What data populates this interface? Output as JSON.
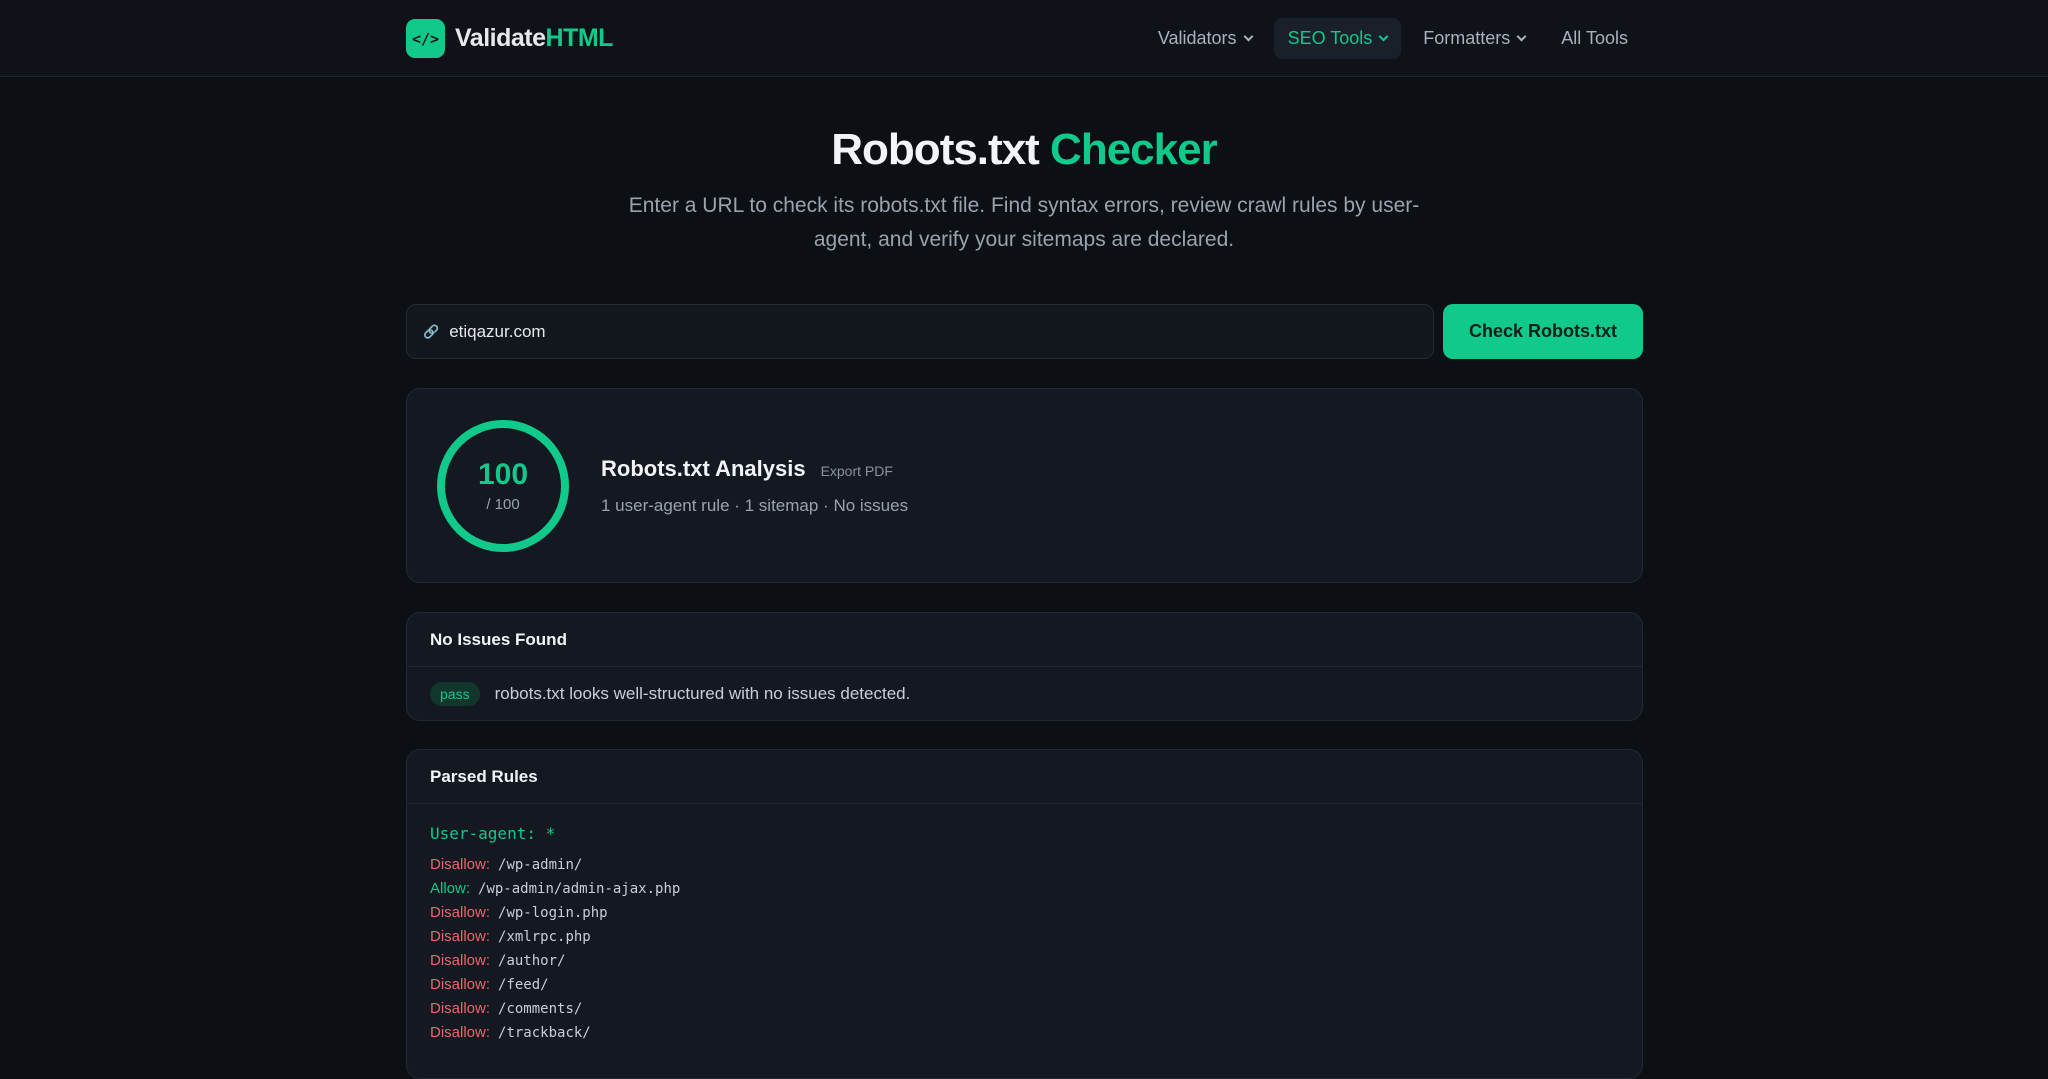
{
  "nav": {
    "brand_prefix": "Validate",
    "brand_suffix": "HTML",
    "logo_glyph": "</>",
    "items": [
      {
        "label": "Validators",
        "has_dropdown": true,
        "active": false
      },
      {
        "label": "SEO Tools",
        "has_dropdown": true,
        "active": true
      },
      {
        "label": "Formatters",
        "has_dropdown": true,
        "active": false
      },
      {
        "label": "All Tools",
        "has_dropdown": false,
        "active": false
      }
    ]
  },
  "hero": {
    "title_main": "Robots.txt",
    "title_accent": "Checker",
    "subtitle": "Enter a URL to check its robots.txt file. Find syntax errors, review crawl rules by user-agent, and verify your sitemaps are declared."
  },
  "search": {
    "value": "etiqazur.com",
    "button_label": "Check Robots.txt"
  },
  "analysis": {
    "score": "100",
    "score_max": "/ 100",
    "title": "Robots.txt Analysis",
    "export_label": "Export PDF",
    "summary": "1 user-agent rule · 1 sitemap · No issues"
  },
  "issues": {
    "header": "No Issues Found",
    "badge": "pass",
    "message": "robots.txt looks well-structured with no issues detected."
  },
  "rules": {
    "header": "Parsed Rules",
    "user_agent_line": "User-agent: *",
    "items": [
      {
        "directive": "Disallow:",
        "type": "disallow",
        "path": "/wp-admin/"
      },
      {
        "directive": "Allow:",
        "type": "allow",
        "path": "/wp-admin/admin-ajax.php"
      },
      {
        "directive": "Disallow:",
        "type": "disallow",
        "path": "/wp-login.php"
      },
      {
        "directive": "Disallow:",
        "type": "disallow",
        "path": "/xmlrpc.php"
      },
      {
        "directive": "Disallow:",
        "type": "disallow",
        "path": "/author/"
      },
      {
        "directive": "Disallow:",
        "type": "disallow",
        "path": "/feed/"
      },
      {
        "directive": "Disallow:",
        "type": "disallow",
        "path": "/comments/"
      },
      {
        "directive": "Disallow:",
        "type": "disallow",
        "path": "/trackback/"
      }
    ]
  },
  "colors": {
    "accent": "#10c98a",
    "background": "#0c0f14",
    "card": "#141921",
    "disallow": "#f0636b"
  }
}
